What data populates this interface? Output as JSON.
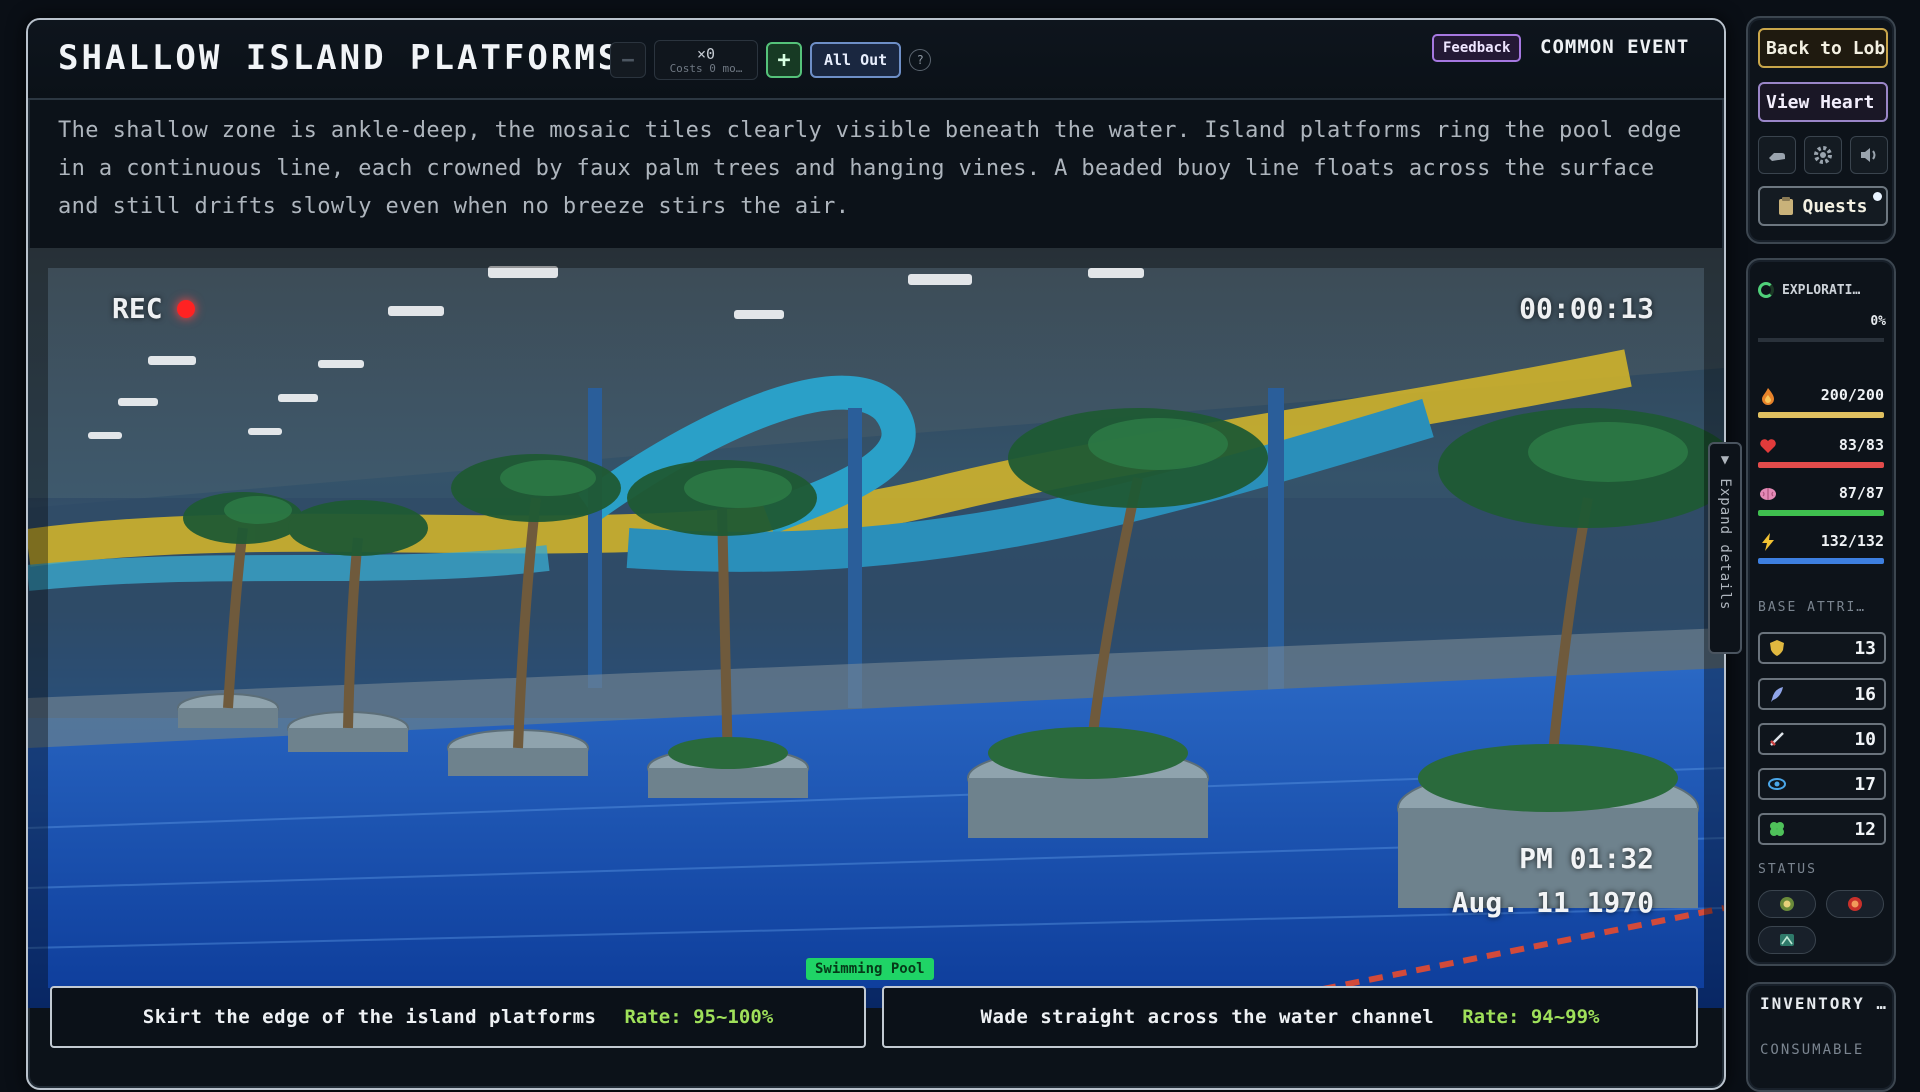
{
  "event": {
    "title": "SHALLOW ISLAND PLATFORMS",
    "type": "COMMON EVENT",
    "feedback_label": "Feedback",
    "description": "The shallow zone is ankle-deep, the mosaic tiles clearly visible beneath the water. Island platforms ring the pool edge in a continuous line, each crowned by faux palm trees and hanging vines. A beaded buoy line floats across the surface and still drifts slowly even when no breeze stirs the air."
  },
  "stepper": {
    "minus": "−",
    "count": "×0",
    "cost": "Costs 0 mo…",
    "plus": "+",
    "all_out": "All Out",
    "help": "?"
  },
  "scene": {
    "rec_label": "REC",
    "timer": "00:00:13",
    "time": "PM 01:32",
    "date": "Aug. 11 1970",
    "location": "Swimming Pool"
  },
  "choices": [
    {
      "text": "Skirt the edge of the island platforms",
      "rate": "Rate: 95~100%"
    },
    {
      "text": "Wade straight across the water channel",
      "rate": "Rate: 94~99%"
    }
  ],
  "expand_label": "▼ Expand details",
  "nav": {
    "back": "Back to Lobby",
    "heart": "View Heart",
    "quests": "Quests"
  },
  "stats": {
    "exploration_label": "EXPLORATI…",
    "exploration_pct": "0%",
    "exploration_fraction": 0,
    "resources": [
      {
        "name": "stamina",
        "value": "200/200",
        "fraction": 1.0,
        "color": "#e0c060"
      },
      {
        "name": "health",
        "value": "83/83",
        "fraction": 1.0,
        "color": "#e24b4b"
      },
      {
        "name": "sanity",
        "value": "87/87",
        "fraction": 1.0,
        "color": "#3fbf4f"
      },
      {
        "name": "energy",
        "value": "132/132",
        "fraction": 1.0,
        "color": "#3d7fe0"
      }
    ],
    "base_label": "BASE ATTRI…",
    "attributes": [
      "13",
      "16",
      "10",
      "17",
      "12"
    ],
    "status_label": "STATUS"
  },
  "inventory": {
    "title": "INVENTORY …",
    "consumable": "CONSUMABLE"
  }
}
